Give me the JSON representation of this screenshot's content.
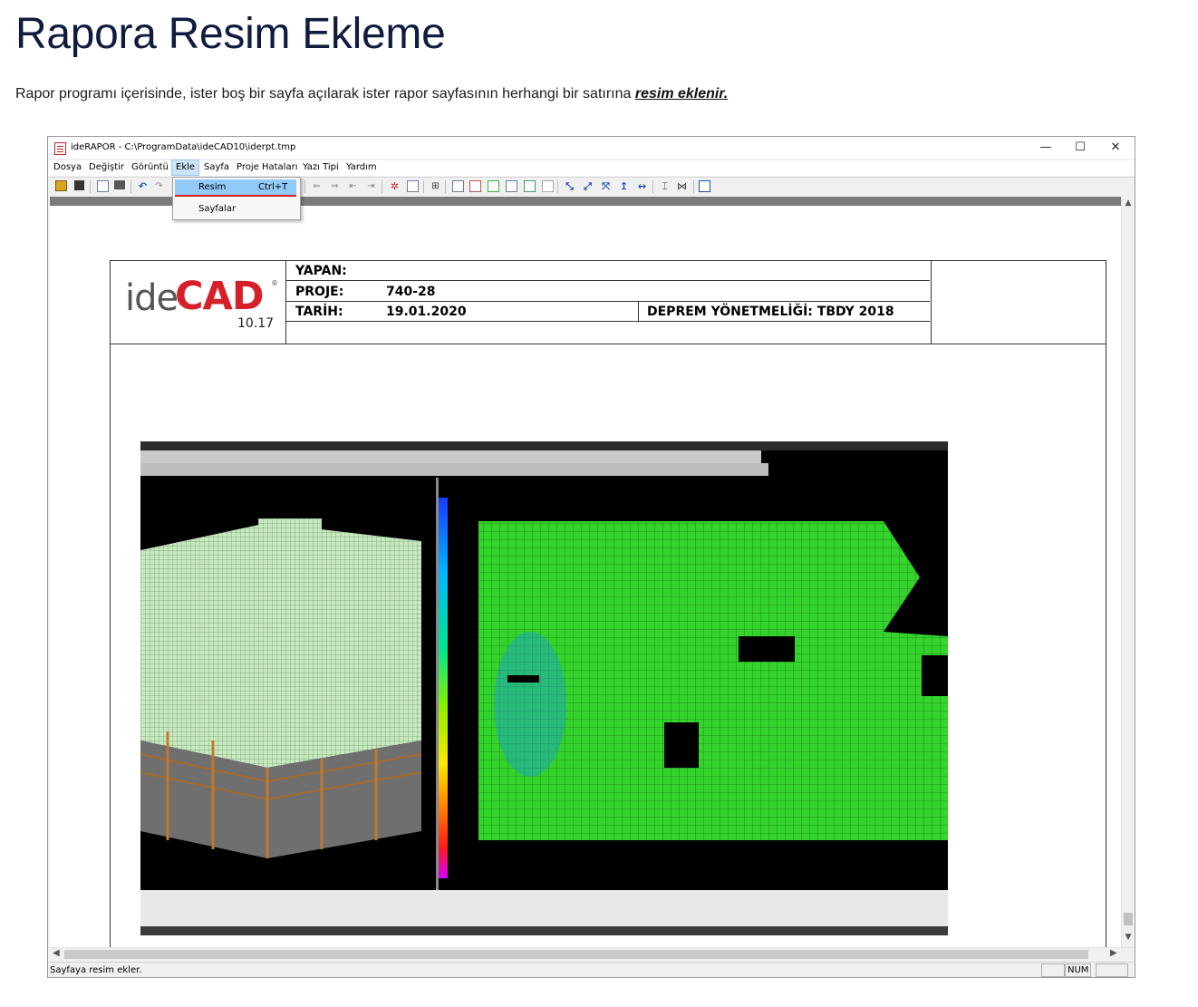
{
  "article": {
    "title": "Rapora Resim Ekleme",
    "intro_text": "Rapor programı içerisinde, ister boş bir sayfa açılarak ister rapor sayfasının herhangi bir satırına ",
    "intro_link": "resim eklenir."
  },
  "window": {
    "title": "ideRAPOR - C:\\ProgramData\\ideCAD10\\iderpt.tmp",
    "controls": {
      "minimize": "—",
      "maximize": "☐",
      "close": "✕"
    }
  },
  "menu": {
    "items": [
      "Dosya",
      "Değiştir",
      "Görüntü",
      "Ekle",
      "Sayfa",
      "Proje Hataları",
      "Yazı Tipi",
      "Yardım"
    ],
    "active": "Ekle"
  },
  "dropdown": {
    "items": [
      {
        "label": "Resim",
        "shortcut": "Ctrl+T"
      },
      {
        "label": "Sayfalar",
        "shortcut": ""
      }
    ]
  },
  "report": {
    "logo": {
      "brand": "ideCAD",
      "version": "10.17"
    },
    "yapan_label": "YAPAN:",
    "yapan_value": "",
    "proje_label": "PROJE:",
    "proje_value": "740-28",
    "tarih_label": "TARİH:",
    "tarih_value": "19.01.2020",
    "deprem": "DEPREM YÖNETMELİĞİ: TBDY 2018"
  },
  "status": {
    "text": "Sayfaya resim ekler.",
    "num": "NUM"
  },
  "colors": {
    "title": "#0f1c3f",
    "logo_red": "#d5202a",
    "menu_highlight": "#91c9f7",
    "mesh_green": "#2fd22f"
  }
}
